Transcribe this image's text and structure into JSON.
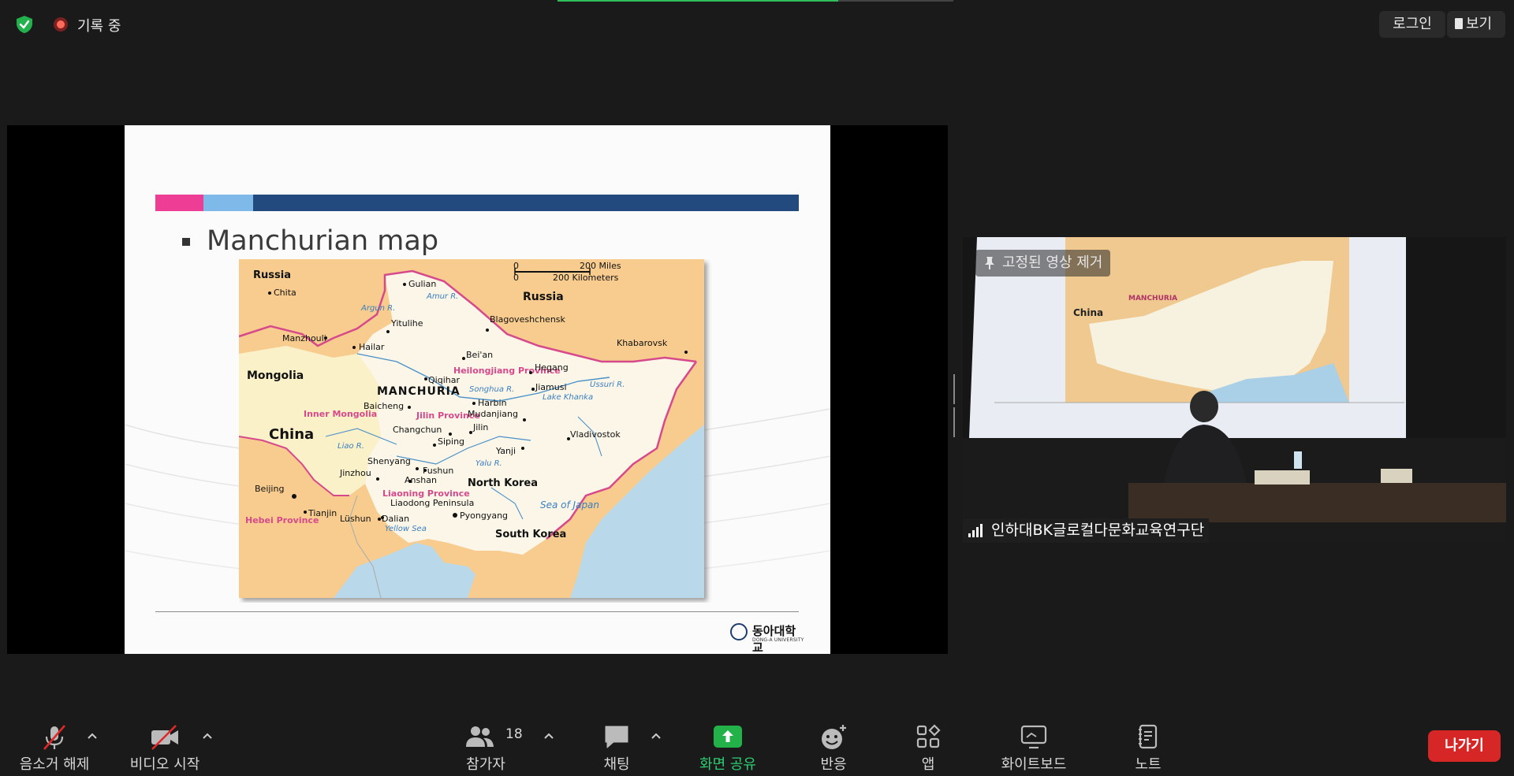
{
  "topbar": {
    "recording_label": "기록 중",
    "login_label": "로그인",
    "view_label": "보기",
    "meeting_progress_pct": 71
  },
  "share": {
    "slide_title": "Manchurian map",
    "logo_name": "동아대학교",
    "logo_sub": "DONG-A UNIVERSITY",
    "map": {
      "scale_top": [
        "0",
        "200 Miles"
      ],
      "scale_bottom": [
        "0",
        "200 Kilometers"
      ],
      "countries": [
        "Russia",
        "Russia",
        "Mongolia",
        "China",
        "North Korea",
        "South Korea"
      ],
      "region": "MANCHURIA",
      "provinces": [
        "Heilongjiang Province",
        "Jilin Province",
        "Liaoning Province",
        "Inner Mongolia",
        "Hebei Province"
      ],
      "water": [
        "Amur R.",
        "Argun R.",
        "Songhua R.",
        "Lake Khanka",
        "Ussuri R.",
        "Liao R.",
        "Yalu R.",
        "Yellow Sea",
        "Sea of Japan"
      ],
      "cities": [
        "Chita",
        "Gulian",
        "Yitulihe",
        "Blagoveshchensk",
        "Manzhouli",
        "Hailar",
        "Khabarovsk",
        "Bei'an",
        "Hegang",
        "Qiqihar",
        "Jiamusi",
        "Harbin",
        "Baicheng",
        "Mudanjiang",
        "Changchun",
        "Jilin",
        "Siping",
        "Yanji",
        "Vladivostok",
        "Shenyang",
        "Fushun",
        "Jinzhou",
        "Anshan",
        "Beijing",
        "Tianjin",
        "Liaodong Peninsula",
        "Lüshun",
        "Dalian",
        "Pyongyang"
      ]
    }
  },
  "video": {
    "pin_label": "고정된 영상 제거",
    "participant_name": "인하대BK글로컬다문화교육연구단"
  },
  "toolbar": {
    "unmute": "음소거 해제",
    "start_video": "비디오 시작",
    "participants": "참가자",
    "participant_count": "18",
    "chat": "채팅",
    "share_screen": "화면 공유",
    "reactions": "반응",
    "apps": "앱",
    "whiteboard": "화이트보드",
    "notes": "노트",
    "leave": "나가기"
  },
  "colors": {
    "share_green": "#2ecc71",
    "leave_red": "#d72626",
    "bar_pink": "#ee3d95",
    "bar_lightblue": "#7fb9ea",
    "bar_navy": "#234a7f"
  }
}
